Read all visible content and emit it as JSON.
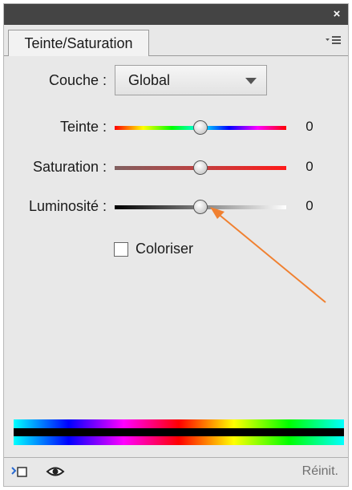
{
  "window": {
    "close_glyph": "×"
  },
  "tab": {
    "label": "Teinte/Saturation"
  },
  "channel": {
    "label": "Couche :",
    "selected": "Global"
  },
  "sliders": [
    {
      "id": "hue",
      "label": "Teinte :",
      "value": "0",
      "position_fraction": 0.5
    },
    {
      "id": "saturation",
      "label": "Saturation :",
      "value": "0",
      "position_fraction": 0.5
    },
    {
      "id": "lightness",
      "label": "Luminosité :",
      "value": "0",
      "position_fraction": 0.5
    }
  ],
  "colorize": {
    "label": "Coloriser",
    "checked": false
  },
  "footer": {
    "reset_label": "Réinit.",
    "icons": [
      "clip-to-layer-icon",
      "eye-icon"
    ]
  },
  "colors": {
    "titlebar": "#444444",
    "panel_bg": "#e8e8e8",
    "annotation_arrow": "#f08030",
    "reset_text": "#707070"
  }
}
